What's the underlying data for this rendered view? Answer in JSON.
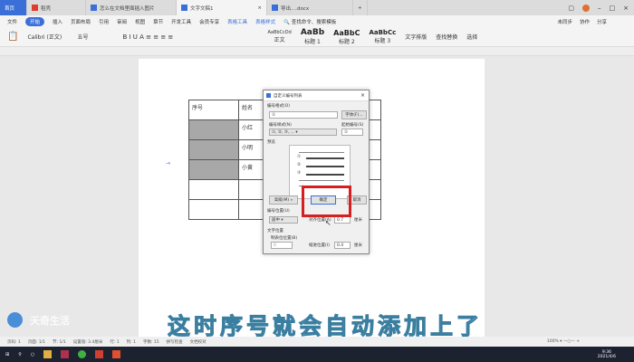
{
  "tabs": [
    {
      "label": "首页"
    },
    {
      "label": "稻壳"
    },
    {
      "label": "怎么在文档里面插入图片"
    },
    {
      "label": "文字文稿1"
    },
    {
      "label": "导出....docx"
    }
  ],
  "menu": [
    "文件",
    "开始",
    "插入",
    "页面布局",
    "引用",
    "审阅",
    "视图",
    "章节",
    "开发工具",
    "会员专享",
    "表格工具",
    "表格样式"
  ],
  "search": "查找命令、搜索模板",
  "right_actions": [
    "未同步",
    "协作",
    "分享"
  ],
  "toolbar": {
    "font": "Calibri (正文)",
    "size": "五号",
    "styles": [
      "正文",
      "标题 1",
      "标题 2",
      "标题 3"
    ],
    "style_samples": [
      "AaBbCcDd",
      "AaBb",
      "AaBbC",
      "AaBbCc"
    ],
    "tools": [
      "文字排版",
      "查找替换",
      "选择"
    ]
  },
  "table": {
    "header": [
      "序号",
      "姓名"
    ],
    "names": [
      "小红",
      "小明",
      "小黄"
    ]
  },
  "dialog": {
    "title": "自定义编号列表",
    "format_label": "编号格式(O)",
    "format_value": "①",
    "font_btn": "字体(F)...",
    "style_label": "编号样式(N)",
    "style_value": "①, ②, ③, ...",
    "start_label": "起始编号(S)",
    "start_value": "①",
    "preview_label": "预览",
    "preview_items": [
      "①",
      "②",
      "③"
    ],
    "advanced_btn": "高级(M) »",
    "ok_btn": "确定",
    "cancel_btn": "取消",
    "position_label": "编号位置(U)",
    "position_value": "居中",
    "align_label": "对齐位置(A)",
    "align_value": "0.7",
    "unit": "厘米",
    "text_pos_label": "文字位置",
    "tab_label": "制表位位置(B)",
    "tab_value": "0",
    "indent_label": "缩进位置(I)",
    "indent_value": "0.4"
  },
  "caption": "这时序号就会自动添加上了",
  "watermark": "天奇生活",
  "status": [
    "页码: 1",
    "页面: 1/1",
    "节: 1/1",
    "设置值: 3.4厘米",
    "行: 1",
    "列: 1",
    "字数: 15",
    "拼写检查",
    "文档校对"
  ],
  "zoom": "100%",
  "clock": {
    "time": "9:36",
    "date": "2021/4/6"
  }
}
